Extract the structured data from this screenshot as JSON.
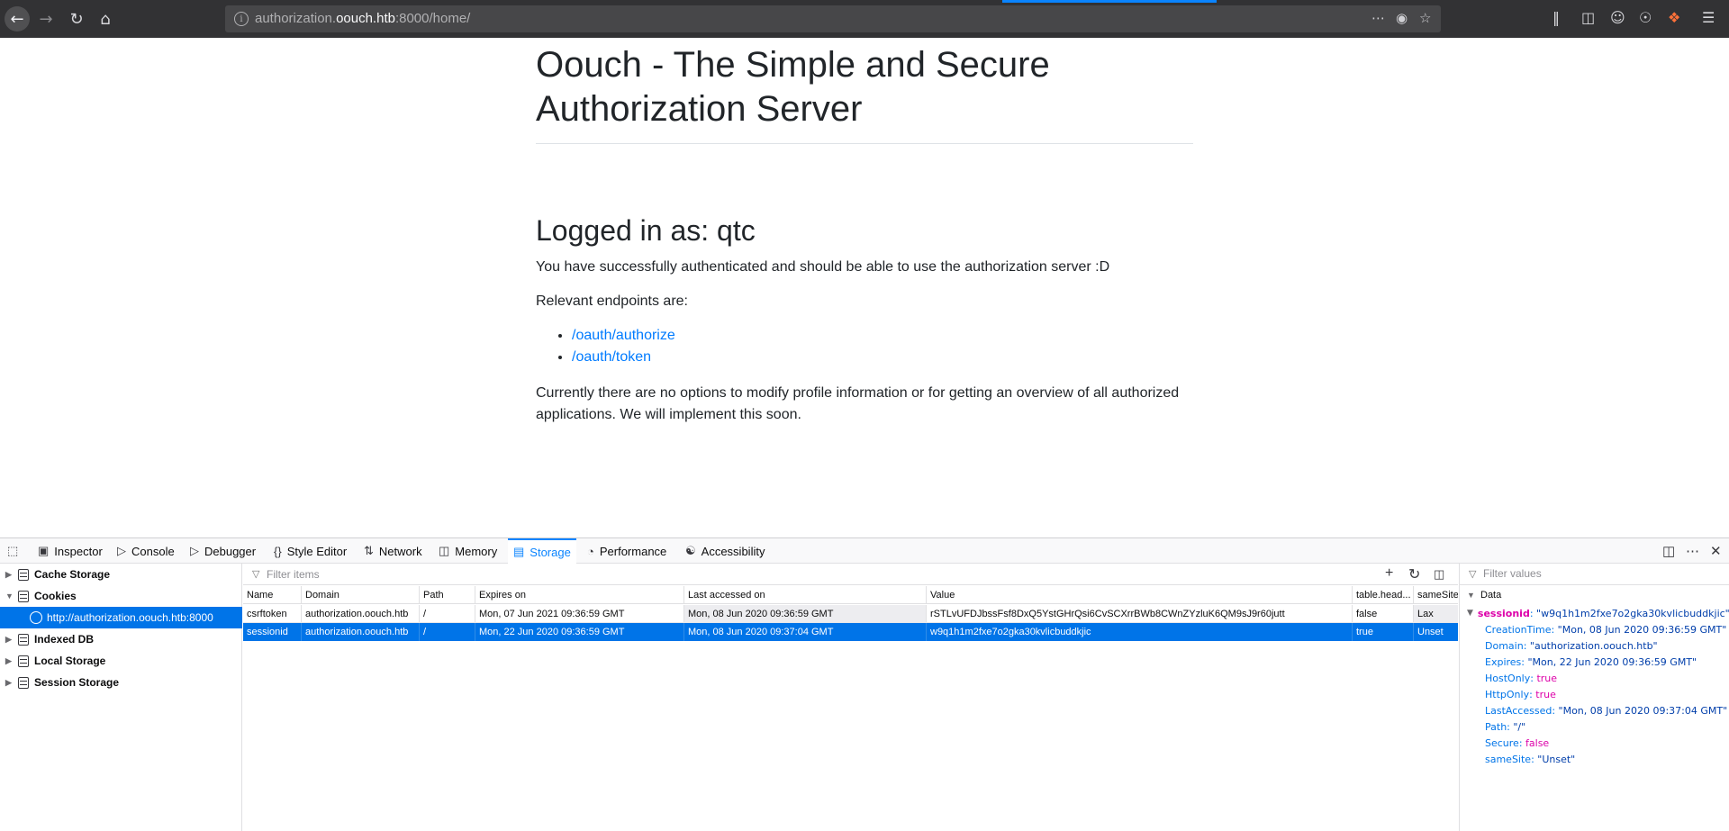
{
  "browser": {
    "url_prefix": "authorization.",
    "url_host": "oouch.htb",
    "url_suffix": ":8000/home/"
  },
  "page": {
    "title": "Oouch - The Simple and Secure Authorization Server",
    "logged_in": "Logged in as: qtc",
    "intro": "You have successfully authenticated and should be able to use the authorization server :D",
    "endpoints_heading": "Relevant endpoints are:",
    "endpoints": [
      "/oauth/authorize",
      "/oauth/token"
    ],
    "closing": "Currently there are no options to modify profile information or for getting an overview of all authorized applications. We will implement this soon."
  },
  "devtools": {
    "tabs": [
      "Inspector",
      "Console",
      "Debugger",
      "Style Editor",
      "Network",
      "Memory",
      "Storage",
      "Performance",
      "Accessibility"
    ],
    "active_tab": "Storage",
    "tree": [
      "Cache Storage",
      "Cookies",
      "http://authorization.oouch.htb:8000",
      "Indexed DB",
      "Local Storage",
      "Session Storage"
    ],
    "filter_placeholder": "Filter items",
    "values_placeholder": "Filter values",
    "columns": [
      "Name",
      "Domain",
      "Path",
      "Expires on",
      "Last accessed on",
      "Value",
      "table.head...",
      "sameSite"
    ],
    "rows": [
      [
        "csrftoken",
        "authorization.oouch.htb",
        "/",
        "Mon, 07 Jun 2021 09:36:59 GMT",
        "Mon, 08 Jun 2020 09:36:59 GMT",
        "rSTLvUFDJbssFsf8DxQ5YstGHrQsi6CvSCXrrBWb8CWnZYzluK6QM9sJ9r60jutt",
        "false",
        "Lax"
      ],
      [
        "sessionid",
        "authorization.oouch.htb",
        "/",
        "Mon, 22 Jun 2020 09:36:59 GMT",
        "Mon, 08 Jun 2020 09:37:04 GMT",
        "w9q1h1m2fxe7o2gka30kvlicbuddkjic",
        "true",
        "Unset"
      ]
    ],
    "data_header": "Data",
    "data_root_key": "sessionid",
    "data_root_value": "\"w9q1h1m2fxe7o2gka30kvlicbuddkjic\"",
    "data_props": [
      {
        "k": "CreationTime",
        "v": "\"Mon, 08 Jun 2020 09:36:59 GMT\"",
        "t": "s"
      },
      {
        "k": "Domain",
        "v": "\"authorization.oouch.htb\"",
        "t": "s"
      },
      {
        "k": "Expires",
        "v": "\"Mon, 22 Jun 2020 09:36:59 GMT\"",
        "t": "s"
      },
      {
        "k": "HostOnly",
        "v": "true",
        "t": "b"
      },
      {
        "k": "HttpOnly",
        "v": "true",
        "t": "b"
      },
      {
        "k": "LastAccessed",
        "v": "\"Mon, 08 Jun 2020 09:37:04 GMT\"",
        "t": "s"
      },
      {
        "k": "Path",
        "v": "\"/\"",
        "t": "s"
      },
      {
        "k": "Secure",
        "v": "false",
        "t": "b"
      },
      {
        "k": "sameSite",
        "v": "\"Unset\"",
        "t": "s"
      }
    ]
  }
}
